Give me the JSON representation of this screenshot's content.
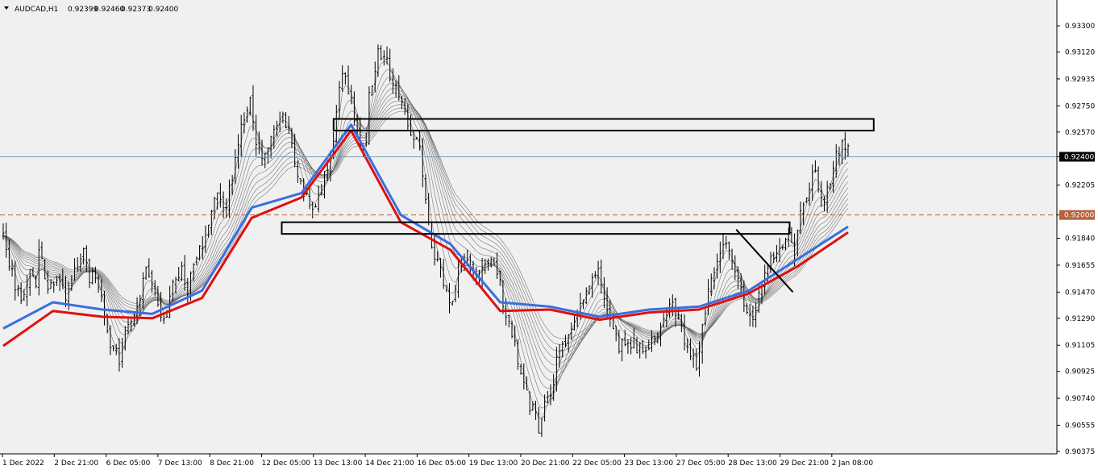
{
  "header": {
    "symbol": "AUDCAD,H1",
    "open": "0.92399",
    "high": "0.92460",
    "low": "0.92373",
    "close": "0.92400",
    "menu_icon": "triangle-down-icon"
  },
  "colors": {
    "background": "#f0f0f0",
    "candles": "#000000",
    "ribbon": "#606060",
    "ema_blue": "#3a6fe0",
    "ema_red": "#e01010",
    "bid_line": "#7a9ab8",
    "level_line": "#b8603a",
    "level_tag": "#b8603a",
    "zones": "#000000",
    "trendline": "#000000"
  },
  "chart_data": {
    "type": "candlestick",
    "symbol": "AUDCAD",
    "timeframe": "H1",
    "ylim": [
      0.90285,
      0.93388
    ],
    "y_ticks": [
      "0.93300",
      "0.93120",
      "0.92935",
      "0.92750",
      "0.92570",
      "0.92400",
      "0.92205",
      "0.92000",
      "0.91840",
      "0.91655",
      "0.91470",
      "0.91290",
      "0.91105",
      "0.90925",
      "0.90740",
      "0.90555",
      "0.90375"
    ],
    "x_ticks": [
      "1 Dec 2022",
      "2 Dec 21:00",
      "6 Dec 05:00",
      "7 Dec 13:00",
      "8 Dec 21:00",
      "12 Dec 05:00",
      "13 Dec 13:00",
      "14 Dec 21:00",
      "16 Dec 05:00",
      "19 Dec 13:00",
      "20 Dec 21:00",
      "22 Dec 05:00",
      "23 Dec 13:00",
      "27 Dec 05:00",
      "28 Dec 13:00",
      "29 Dec 21:00",
      "2 Jan 08:00"
    ],
    "current_price": {
      "label": "0.92400",
      "value": 0.924
    },
    "horizontal_level": {
      "label": "0.92000",
      "value": 0.92
    },
    "zones": [
      {
        "x_start": "13 Dec 13:00",
        "x_end": "2 Jan 08:00",
        "top": 0.9266,
        "bottom": 0.9258
      },
      {
        "x_start": "12 Dec 05:00",
        "x_end": "29 Dec 21:00",
        "top": 0.9195,
        "bottom": 0.9187
      }
    ],
    "trendline": {
      "start": {
        "time": "28 Dec 13:00",
        "price": 0.919
      },
      "end": {
        "time": "29 Dec 21:00",
        "price": 0.9147
      }
    },
    "price_path": [
      [
        0.9186,
        0.916,
        0.914,
        0.9165,
        0.9145
      ],
      [
        0.9175,
        0.915,
        0.916,
        0.914,
        0.916,
        0.9175,
        0.915
      ],
      [
        0.9165,
        0.914,
        0.911,
        0.91,
        0.9125,
        0.913
      ],
      [
        0.914,
        0.916,
        0.915,
        0.9125,
        0.915,
        0.916,
        0.9145
      ],
      [
        0.9155,
        0.9175,
        0.919,
        0.9215,
        0.9205,
        0.924,
        0.927,
        0.928
      ],
      [
        0.926,
        0.9235,
        0.925,
        0.927,
        0.926,
        0.923,
        0.921,
        0.92
      ],
      [
        0.921,
        0.9225,
        0.925,
        0.93,
        0.928,
        0.9245,
        0.926
      ],
      [
        0.928,
        0.931,
        0.9305,
        0.9285,
        0.927,
        0.925,
        0.9245
      ],
      [
        0.923,
        0.918,
        0.916,
        0.914,
        0.9155
      ],
      [
        0.917,
        0.9165,
        0.9155,
        0.917,
        0.9165,
        0.915
      ],
      [
        0.914,
        0.912,
        0.909,
        0.907,
        0.9055,
        0.9075,
        0.909
      ],
      [
        0.91,
        0.9115,
        0.913,
        0.9145,
        0.9155,
        0.9165
      ],
      [
        0.915,
        0.913,
        0.911,
        0.9115,
        0.911,
        0.9105
      ],
      [
        0.911,
        0.9115,
        0.913,
        0.914,
        0.912,
        0.9105,
        0.9095
      ],
      [
        0.911,
        0.9145,
        0.917,
        0.918,
        0.916,
        0.9145
      ],
      [
        0.9135,
        0.9125,
        0.915,
        0.917,
        0.918,
        0.9185,
        0.917
      ],
      [
        0.919,
        0.9215,
        0.923,
        0.9205,
        0.9235,
        0.925,
        0.924
      ]
    ],
    "ema_blue_path": [
      0.9122,
      0.914,
      0.9135,
      0.9132,
      0.9148,
      0.9205,
      0.9215,
      0.9262,
      0.92,
      0.918,
      0.914,
      0.9137,
      0.913,
      0.9135,
      0.9137,
      0.9148,
      0.917,
      0.9192
    ],
    "ema_red_path": [
      0.911,
      0.9134,
      0.913,
      0.9129,
      0.9143,
      0.9198,
      0.9212,
      0.9258,
      0.9195,
      0.9176,
      0.9134,
      0.9135,
      0.9128,
      0.9133,
      0.9135,
      0.9146,
      0.9165,
      0.9188
    ],
    "ema_count": 11
  }
}
